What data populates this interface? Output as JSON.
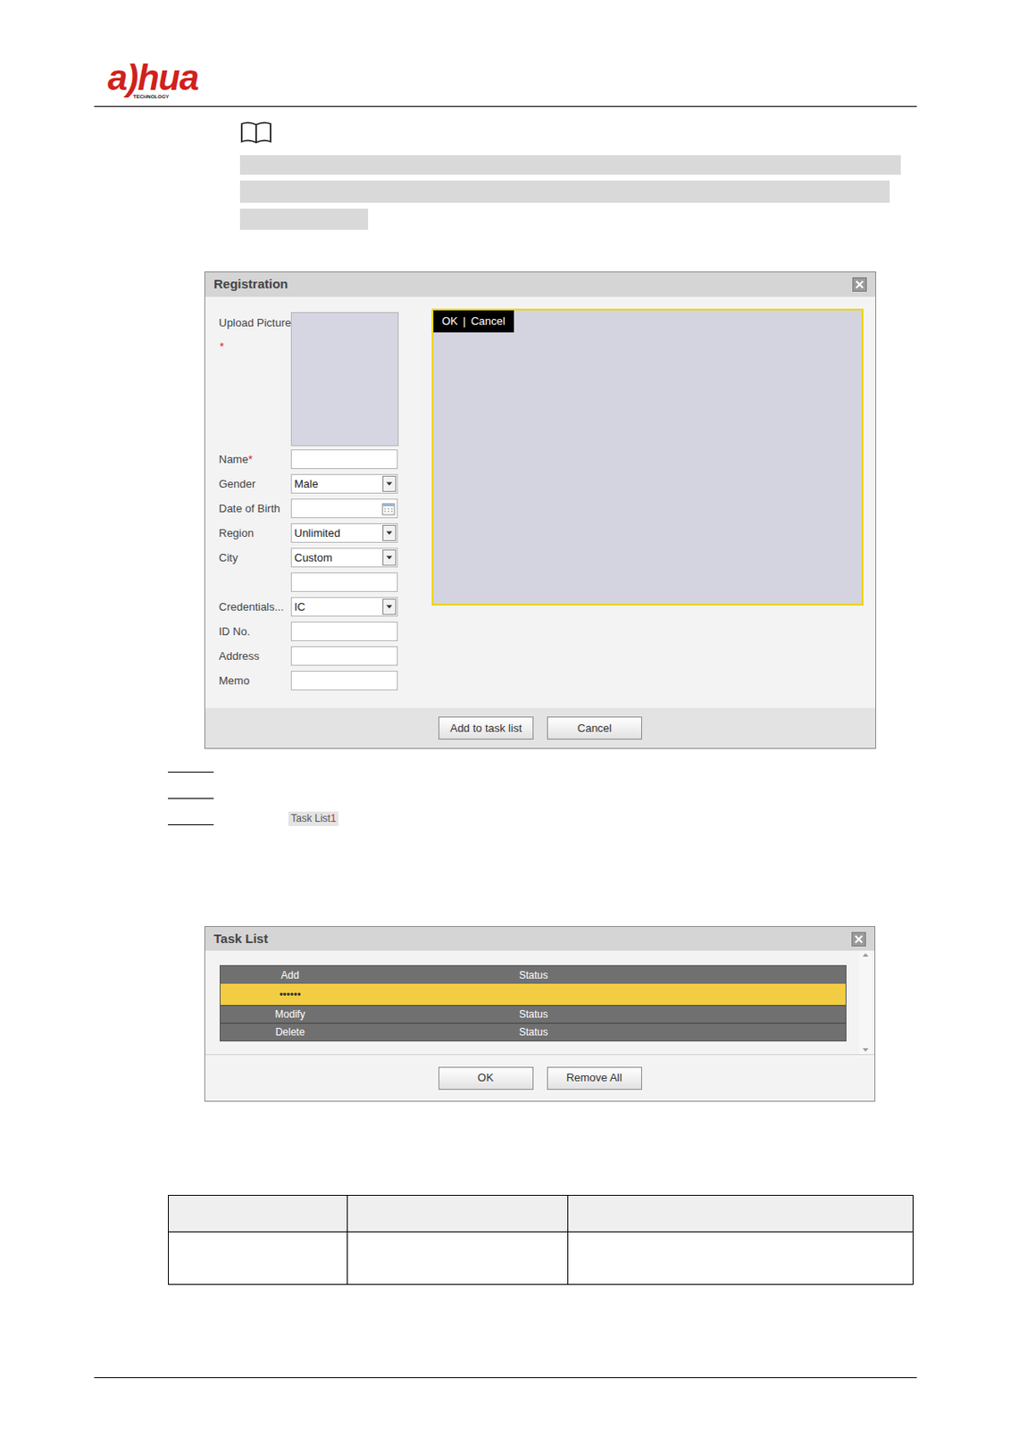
{
  "header": {
    "logo": "a)hua",
    "logo_sub": "TECHNOLOGY"
  },
  "registration": {
    "title": "Registration",
    "upload_label": "Upload Picture",
    "required_mark": "*",
    "crop_toolbar": {
      "ok": "OK",
      "separator": "|",
      "cancel": "Cancel"
    },
    "fields": [
      {
        "label": "Name",
        "required": true,
        "kind": "text",
        "value": ""
      },
      {
        "label": "Gender",
        "required": false,
        "kind": "select",
        "value": "Male"
      },
      {
        "label": "Date of Birth",
        "required": false,
        "kind": "date",
        "value": ""
      },
      {
        "label": "Region",
        "required": false,
        "kind": "select",
        "value": "Unlimited"
      },
      {
        "label": "City",
        "required": false,
        "kind": "select",
        "value": "Custom"
      },
      {
        "label": "",
        "required": false,
        "kind": "text",
        "value": ""
      },
      {
        "label": "Credentials...",
        "required": false,
        "kind": "select",
        "value": "IC"
      },
      {
        "label": "ID No.",
        "required": false,
        "kind": "text",
        "value": ""
      },
      {
        "label": "Address",
        "required": false,
        "kind": "text",
        "value": ""
      },
      {
        "label": "Memo",
        "required": false,
        "kind": "text",
        "value": ""
      }
    ],
    "buttons": [
      "Add to task list",
      "Cancel"
    ]
  },
  "steps": [
    {
      "chip": null
    },
    {
      "chip": null
    },
    {
      "chip": {
        "label": "Task List",
        "badge": "1"
      }
    }
  ],
  "task_list": {
    "title": "Task List",
    "sections": [
      {
        "label": "Add",
        "status": "Status",
        "rows": [
          {
            "value": "••••••",
            "selected": true
          }
        ]
      },
      {
        "label": "Modify",
        "status": "Status",
        "rows": []
      },
      {
        "label": "Delete",
        "status": "Status",
        "rows": []
      }
    ],
    "buttons": [
      "OK",
      "Remove All"
    ]
  },
  "table": {
    "columns": [
      "",
      "",
      ""
    ],
    "rows": [
      [
        "",
        "",
        ""
      ]
    ]
  }
}
